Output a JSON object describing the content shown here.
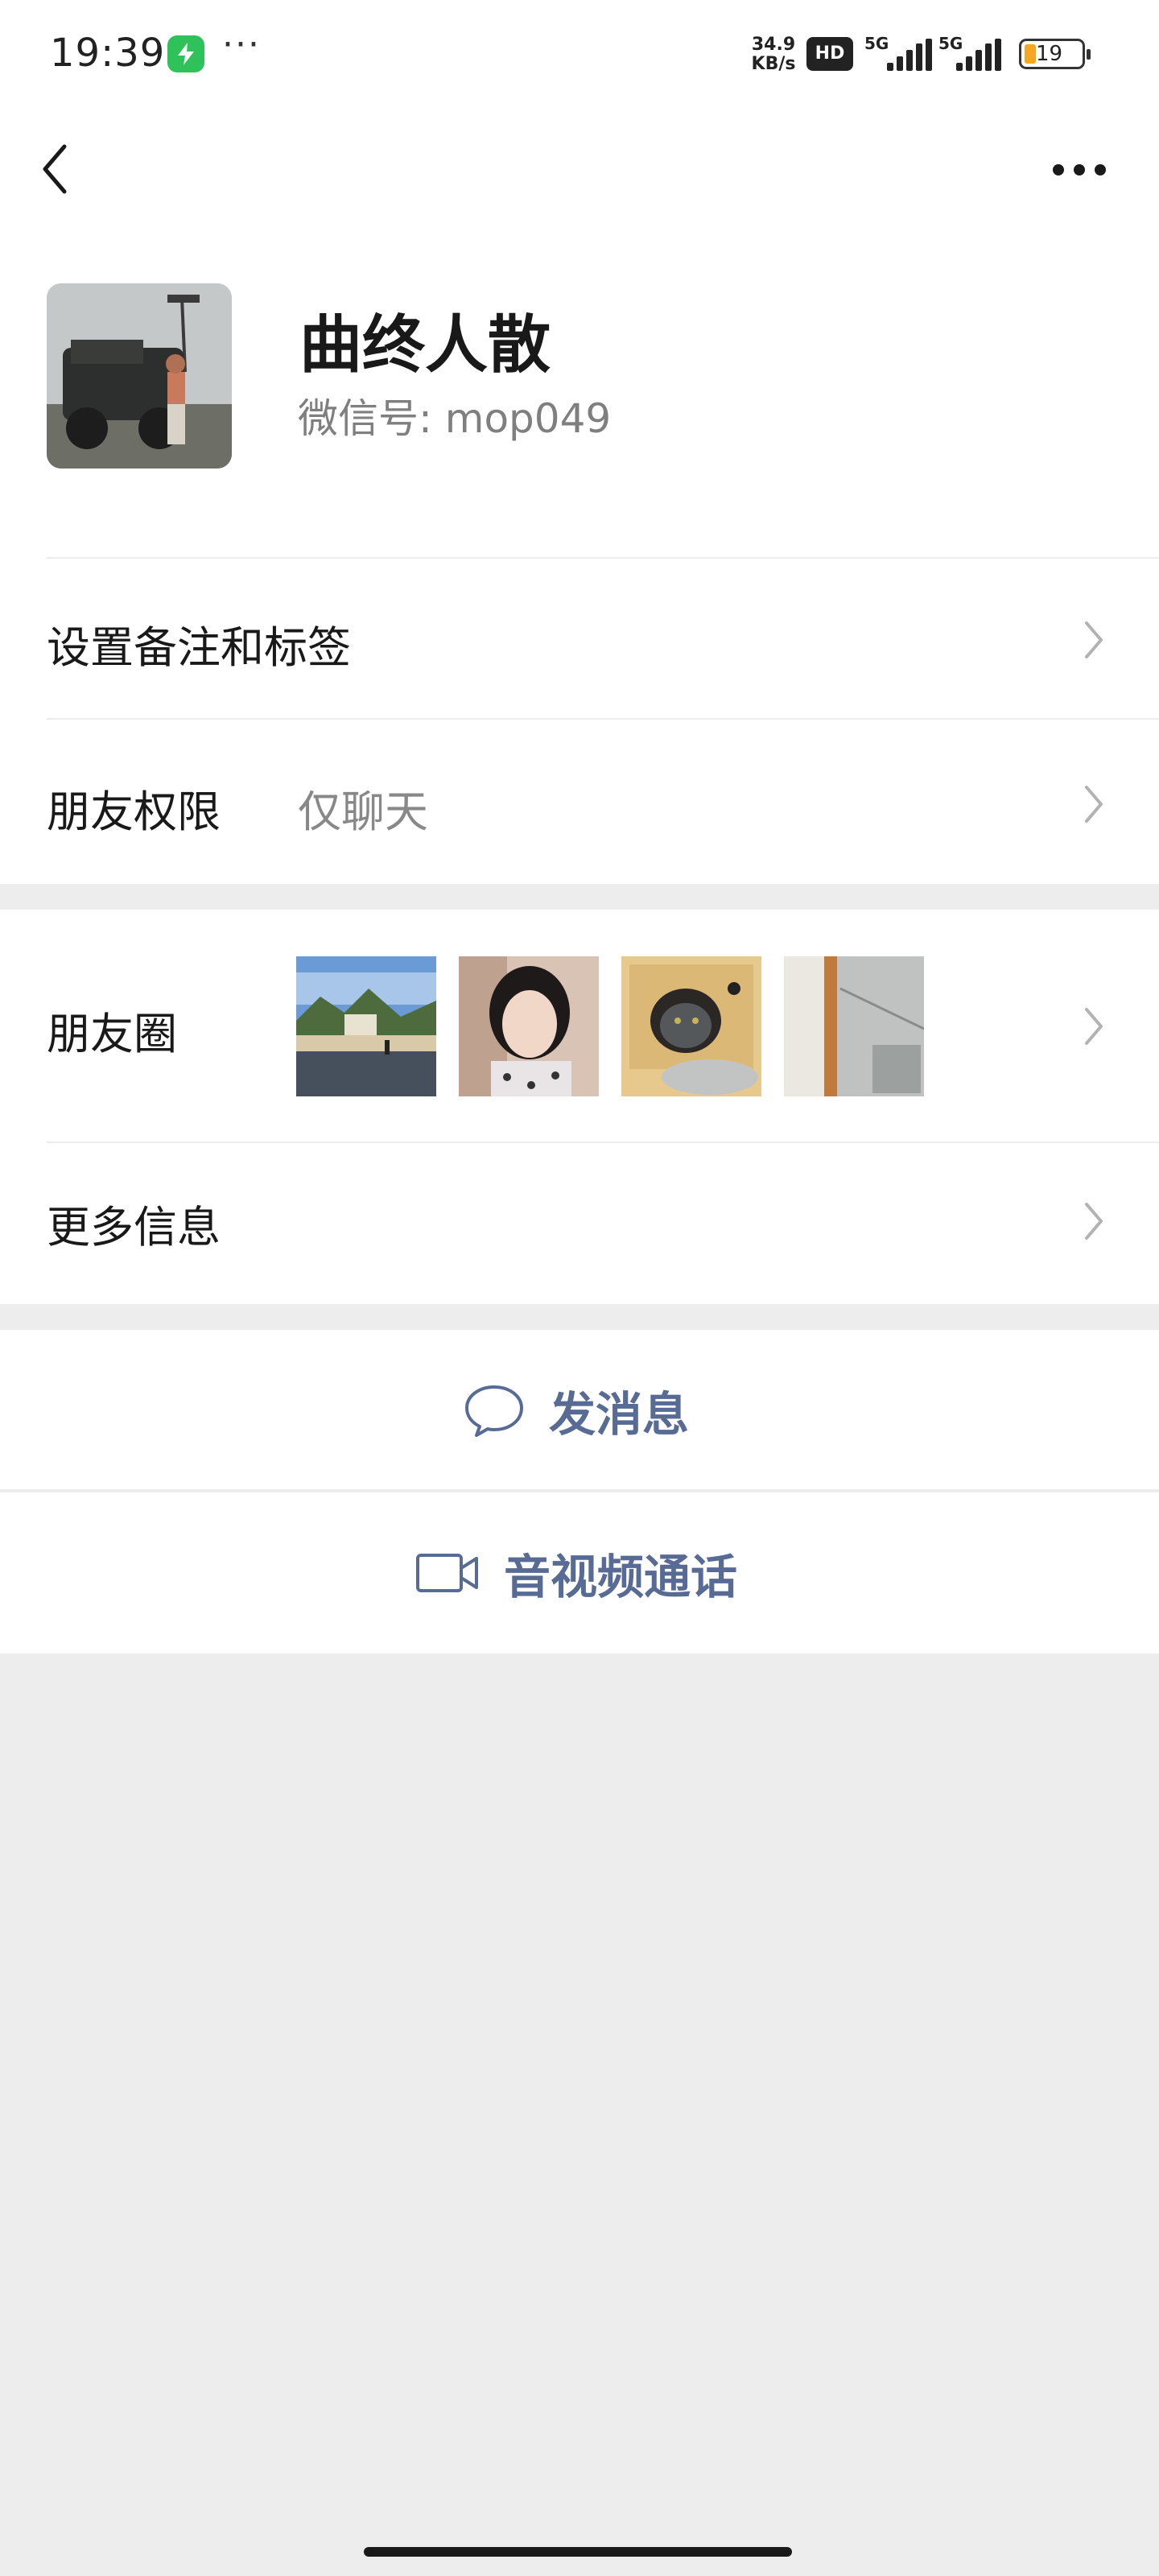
{
  "status_bar": {
    "time": "19:39",
    "more_indicator": "···",
    "network_speed_value": "34.9",
    "network_speed_unit": "KB/s",
    "hd_label": "HD",
    "signal_1_label": "5G",
    "signal_2_label": "5G",
    "battery_level": "19",
    "battery_color": "#f5a623"
  },
  "nav": {
    "back_icon": "chevron-left-icon",
    "more_icon": "more-horizontal-icon"
  },
  "profile": {
    "name": "曲终人散",
    "wechat_id": "微信号: mop049"
  },
  "rows": {
    "remark_label": "设置备注和标签",
    "permission_label": "朋友权限",
    "permission_value": "仅聊天",
    "moments_label": "朋友圈",
    "more_info_label": "更多信息"
  },
  "actions": {
    "send_message": "发消息",
    "call": "音视频通话",
    "accent_color": "#576b95"
  }
}
